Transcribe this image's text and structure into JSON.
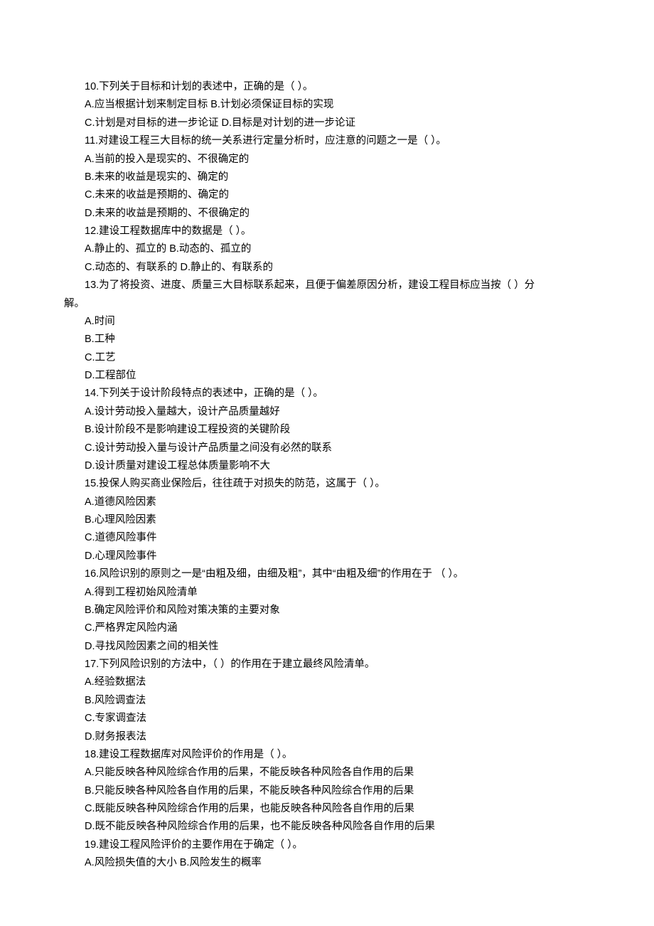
{
  "lines": [
    "10.下列关于目标和计划的表述中，正确的是（ ）。",
    "A.应当根据计划来制定目标  B.计划必须保证目标的实现",
    "C.计划是对目标的进一步论证  D.目标是对计划的进一步论证",
    "11.对建设工程三大目标的统一关系进行定量分析时，应注意的问题之一是（ ）。",
    "A.当前的投入是现实的、不很确定的",
    "B.未来的收益是现实的、确定的",
    "C.未来的收益是预期的、确定的",
    "D.未来的收益是预期的、不很确定的",
    "12.建设工程数据库中的数据是（ ）。",
    "A.静止的、孤立的  B.动态的、孤立的",
    "C.动态的、有联系的  D.静止的、有联系的",
    "13.为了将投资、进度、质量三大目标联系起来，且便于偏差原因分析，建设工程目标应当按（ ）分",
    "__CONT__解。",
    "A.时间",
    "B.工种",
    "C.工艺",
    "D.工程部位",
    "14.下列关于设计阶段特点的表述中，正确的是（ ）。",
    "A.设计劳动投入量越大，设计产品质量越好",
    "B.设计阶段不是影响建设工程投资的关键阶段",
    "C.设计劳动投入量与设计产品质量之间没有必然的联系",
    "D.设计质量对建设工程总体质量影响不大",
    "15.投保人购买商业保险后，往往疏于对损失的防范，这属于（ ）。",
    "A.道德风险因素",
    "B.心理风险因素",
    "C.道德风险事件",
    "D.心理风险事件",
    "16.风险识别的原则之一是“由粗及细，由细及粗”，其中“由粗及细”的作用在于 （ ）。",
    "A.得到工程初始风险清单",
    "B.确定风险评价和风险对策决策的主要对象",
    "C.严格界定风险内涵",
    "D.寻找风险因素之间的相关性",
    "17.下列风险识别的方法中，（ ）的作用在于建立最终风险清单。",
    "A.经验数据法",
    "B.风险调查法",
    "C.专家调查法",
    "D.财务报表法",
    "18.建设工程数据库对风险评价的作用是（ ）。",
    "A.只能反映各种风险综合作用的后果，不能反映各种风险各自作用的后果",
    "B.只能反映各种风险各自作用的后果，不能反映各种风险综合作用的后果",
    "C.既能反映各种风险综合作用的后果，也能反映各种风险各自作用的后果",
    "D.既不能反映各种风险综合作用的后果，也不能反映各种风险各自作用的后果",
    "19.建设工程风险评价的主要作用在于确定（ ）。",
    "A.风险损失值的大小  B.风险发生的概率"
  ]
}
